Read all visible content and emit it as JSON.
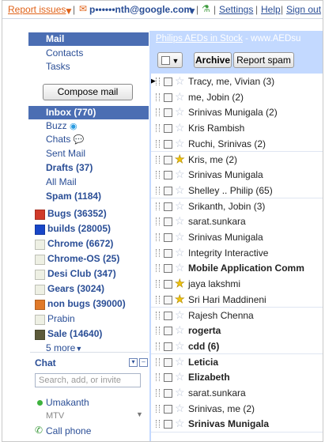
{
  "topbar": {
    "report_issues": "Report issues",
    "account": "p••••••nth@google.com",
    "settings": "Settings",
    "help": "Help",
    "sign_out": "Sign out"
  },
  "sidebar": {
    "nav_top": [
      "Mail",
      "Contacts",
      "Tasks"
    ],
    "compose": "Compose mail",
    "folders": [
      {
        "label": "Inbox (770)",
        "bold": true,
        "selected": true
      },
      {
        "label": "Buzz",
        "bold": false
      },
      {
        "label": "Chats",
        "bold": false
      },
      {
        "label": "Sent Mail",
        "bold": false
      },
      {
        "label": "Drafts (37)",
        "bold": true
      },
      {
        "label": "All Mail",
        "bold": false
      },
      {
        "label": "Spam (1184)",
        "bold": true
      }
    ],
    "labels": [
      {
        "name": "Bugs (36352)",
        "color": "#d03a2a",
        "bold": true
      },
      {
        "name": "builds (28005)",
        "color": "#1846c8",
        "bold": true
      },
      {
        "name": "Chrome (6672)",
        "color": "#eef0e4",
        "bold": true
      },
      {
        "name": "Chrome-OS (25)",
        "color": "#eef0e4",
        "bold": true
      },
      {
        "name": "Desi Club (347)",
        "color": "#eef0e4",
        "bold": true
      },
      {
        "name": "Gears (3024)",
        "color": "#eef0e4",
        "bold": true
      },
      {
        "name": "non bugs (39000)",
        "color": "#e07a2a",
        "bold": true
      },
      {
        "name": "Prabin",
        "color": "#eef0e4",
        "bold": false
      },
      {
        "name": "Sale (14640)",
        "color": "#5c5a3a",
        "bold": true
      }
    ],
    "more": "5 more",
    "chat": {
      "header": "Chat",
      "search_placeholder": "Search, add, or invite",
      "contact_name": "Umakanth",
      "contact_status": "MTV",
      "call_phone": "Call phone"
    }
  },
  "ad": {
    "title": "Philips AEDs in Stock",
    "url": " - www.AEDsu"
  },
  "toolbar": {
    "archive": "Archive",
    "report_spam": "Report spam"
  },
  "messages": [
    {
      "sender": "Tracy, me, Vivian (3)",
      "unread": false,
      "starred": false
    },
    {
      "sender": "me, Jobin (2)",
      "unread": false,
      "starred": false
    },
    {
      "sender": "Srinivas Munigala (2)",
      "unread": false,
      "starred": false
    },
    {
      "sender": "Kris Rambish",
      "unread": false,
      "starred": false
    },
    {
      "sender": "Ruchi, Srinivas (2)",
      "unread": false,
      "starred": false
    },
    {
      "sender": "Kris, me (2)",
      "unread": false,
      "starred": true
    },
    {
      "sender": "Srinivas Munigala",
      "unread": false,
      "starred": false
    },
    {
      "sender": "Shelley .. Philip (65)",
      "unread": false,
      "starred": false
    },
    {
      "sender": "Srikanth, Jobin (3)",
      "unread": false,
      "starred": false
    },
    {
      "sender": "sarat.sunkara",
      "unread": false,
      "starred": false
    },
    {
      "sender": "Srinivas Munigala",
      "unread": false,
      "starred": false
    },
    {
      "sender": "Integrity Interactive",
      "unread": false,
      "starred": false
    },
    {
      "sender": "Mobile Application Comm",
      "unread": true,
      "starred": false
    },
    {
      "sender": "jaya lakshmi",
      "unread": false,
      "starred": true
    },
    {
      "sender": "Sri Hari Maddineni",
      "unread": false,
      "starred": true
    },
    {
      "sender": "Rajesh Chenna",
      "unread": false,
      "starred": false
    },
    {
      "sender": "rogerta",
      "unread": true,
      "starred": false
    },
    {
      "sender": "cdd (6)",
      "unread": true,
      "starred": false
    },
    {
      "sender": "Leticia",
      "unread": true,
      "starred": false
    },
    {
      "sender": "Elizabeth",
      "unread": true,
      "starred": false
    },
    {
      "sender": "sarat.sunkara",
      "unread": false,
      "starred": false
    },
    {
      "sender": "Srinivas, me (2)",
      "unread": false,
      "starred": false
    },
    {
      "sender": "Srinivas Munigala",
      "unread": true,
      "starred": false
    }
  ]
}
